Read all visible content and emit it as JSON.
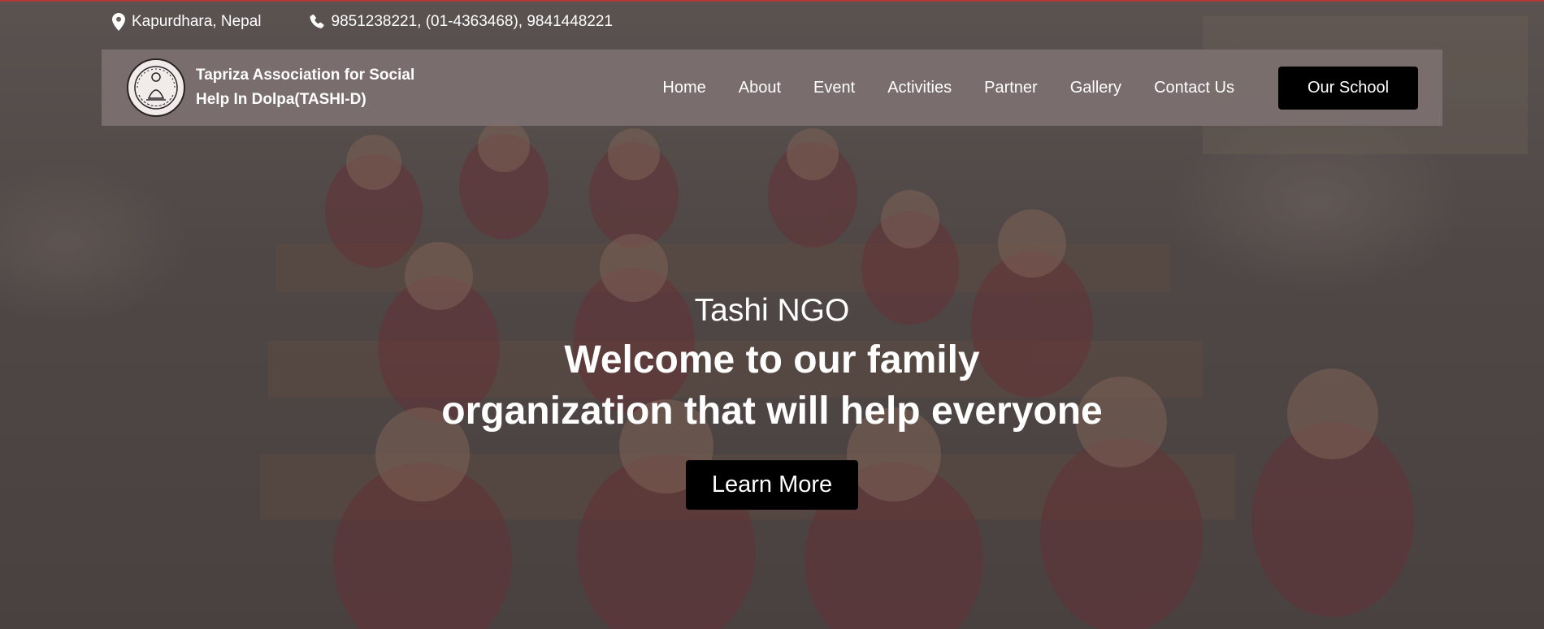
{
  "contact": {
    "location": "Kapurdhara, Nepal",
    "phones": "9851238221, (01-4363468), 9841448221",
    "location_icon": "map-pin-icon",
    "phone_icon": "phone-icon"
  },
  "nav": {
    "brand": "Tapriza Association for Social Help In Dolpa(TASHI-D)",
    "links": [
      "Home",
      "About",
      "Event",
      "Activities",
      "Partner",
      "Gallery",
      "Contact Us"
    ],
    "cta": "Our School"
  },
  "hero": {
    "subtitle": "Tashi NGO",
    "title_line1": "Welcome to our family",
    "title_line2": "organization that will help everyone",
    "button": "Learn More"
  },
  "colors": {
    "nav_bg": "#7d7070",
    "button_bg": "#000000",
    "text": "#ffffff",
    "accent_line": "#b03a3a"
  }
}
